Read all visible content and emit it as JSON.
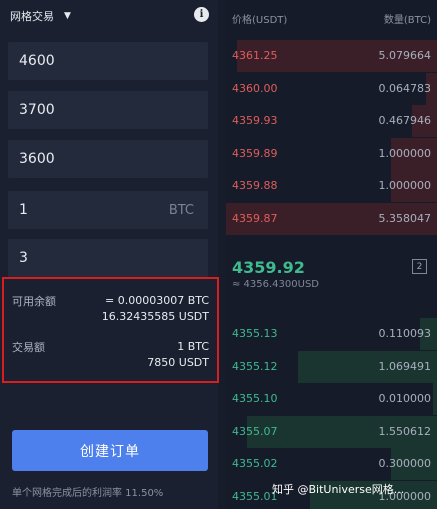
{
  "header": {
    "title": "网格交易",
    "caret": "▼",
    "info_icon": "i"
  },
  "form": {
    "upper_price": "4600",
    "middle_price": "3700",
    "lower_price": "3600",
    "quantity": "1",
    "quantity_unit": "BTC",
    "grid_count": "3"
  },
  "summary": {
    "available_label": "可用余额",
    "available_btc": "= 0.00003007 BTC",
    "available_usdt": "16.32435585 USDT",
    "trade_label": "交易额",
    "trade_btc": "1 BTC",
    "trade_usdt": "7850 USDT"
  },
  "create_button": "创建订单",
  "profit_text": "单个网格完成后的利润率 11.50%",
  "orderbook": {
    "price_header": "价格(USDT)",
    "amount_header": "数量(BTC)",
    "asks": [
      {
        "price": "4361.25",
        "amount": "5.079664",
        "depth": 0.95
      },
      {
        "price": "4360.00",
        "amount": "0.064783",
        "depth": 0.05
      },
      {
        "price": "4359.93",
        "amount": "0.467946",
        "depth": 0.12
      },
      {
        "price": "4359.89",
        "amount": "1.000000",
        "depth": 0.22
      },
      {
        "price": "4359.88",
        "amount": "1.000000",
        "depth": 0.22
      },
      {
        "price": "4359.87",
        "amount": "5.358047",
        "depth": 1.0
      }
    ],
    "last_price": "4359.92",
    "last_price_fiat": "≈ 4356.4300USD",
    "depth_level": "2",
    "bids": [
      {
        "price": "4355.13",
        "amount": "0.110093",
        "depth": 0.08
      },
      {
        "price": "4355.12",
        "amount": "1.069491",
        "depth": 0.66
      },
      {
        "price": "4355.10",
        "amount": "0.010000",
        "depth": 0.02
      },
      {
        "price": "4355.07",
        "amount": "1.550612",
        "depth": 0.9
      },
      {
        "price": "4355.02",
        "amount": "0.300000",
        "depth": 0.22
      },
      {
        "price": "4355.01",
        "amount": "1.000000",
        "depth": 0.6
      }
    ]
  },
  "watermark": "知乎 @BitUniverse网格..."
}
